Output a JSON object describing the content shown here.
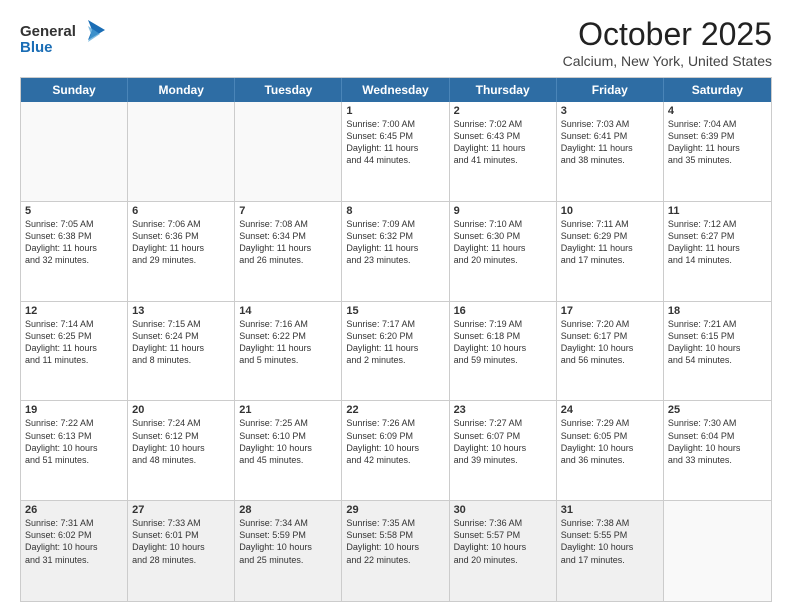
{
  "header": {
    "logo_general": "General",
    "logo_blue": "Blue",
    "month_title": "October 2025",
    "location": "Calcium, New York, United States"
  },
  "weekdays": [
    "Sunday",
    "Monday",
    "Tuesday",
    "Wednesday",
    "Thursday",
    "Friday",
    "Saturday"
  ],
  "weeks": [
    [
      {
        "day": "",
        "text": "",
        "empty": true
      },
      {
        "day": "",
        "text": "",
        "empty": true
      },
      {
        "day": "",
        "text": "",
        "empty": true
      },
      {
        "day": "1",
        "text": "Sunrise: 7:00 AM\nSunset: 6:45 PM\nDaylight: 11 hours\nand 44 minutes."
      },
      {
        "day": "2",
        "text": "Sunrise: 7:02 AM\nSunset: 6:43 PM\nDaylight: 11 hours\nand 41 minutes."
      },
      {
        "day": "3",
        "text": "Sunrise: 7:03 AM\nSunset: 6:41 PM\nDaylight: 11 hours\nand 38 minutes."
      },
      {
        "day": "4",
        "text": "Sunrise: 7:04 AM\nSunset: 6:39 PM\nDaylight: 11 hours\nand 35 minutes."
      }
    ],
    [
      {
        "day": "5",
        "text": "Sunrise: 7:05 AM\nSunset: 6:38 PM\nDaylight: 11 hours\nand 32 minutes."
      },
      {
        "day": "6",
        "text": "Sunrise: 7:06 AM\nSunset: 6:36 PM\nDaylight: 11 hours\nand 29 minutes."
      },
      {
        "day": "7",
        "text": "Sunrise: 7:08 AM\nSunset: 6:34 PM\nDaylight: 11 hours\nand 26 minutes."
      },
      {
        "day": "8",
        "text": "Sunrise: 7:09 AM\nSunset: 6:32 PM\nDaylight: 11 hours\nand 23 minutes."
      },
      {
        "day": "9",
        "text": "Sunrise: 7:10 AM\nSunset: 6:30 PM\nDaylight: 11 hours\nand 20 minutes."
      },
      {
        "day": "10",
        "text": "Sunrise: 7:11 AM\nSunset: 6:29 PM\nDaylight: 11 hours\nand 17 minutes."
      },
      {
        "day": "11",
        "text": "Sunrise: 7:12 AM\nSunset: 6:27 PM\nDaylight: 11 hours\nand 14 minutes."
      }
    ],
    [
      {
        "day": "12",
        "text": "Sunrise: 7:14 AM\nSunset: 6:25 PM\nDaylight: 11 hours\nand 11 minutes."
      },
      {
        "day": "13",
        "text": "Sunrise: 7:15 AM\nSunset: 6:24 PM\nDaylight: 11 hours\nand 8 minutes."
      },
      {
        "day": "14",
        "text": "Sunrise: 7:16 AM\nSunset: 6:22 PM\nDaylight: 11 hours\nand 5 minutes."
      },
      {
        "day": "15",
        "text": "Sunrise: 7:17 AM\nSunset: 6:20 PM\nDaylight: 11 hours\nand 2 minutes."
      },
      {
        "day": "16",
        "text": "Sunrise: 7:19 AM\nSunset: 6:18 PM\nDaylight: 10 hours\nand 59 minutes."
      },
      {
        "day": "17",
        "text": "Sunrise: 7:20 AM\nSunset: 6:17 PM\nDaylight: 10 hours\nand 56 minutes."
      },
      {
        "day": "18",
        "text": "Sunrise: 7:21 AM\nSunset: 6:15 PM\nDaylight: 10 hours\nand 54 minutes."
      }
    ],
    [
      {
        "day": "19",
        "text": "Sunrise: 7:22 AM\nSunset: 6:13 PM\nDaylight: 10 hours\nand 51 minutes."
      },
      {
        "day": "20",
        "text": "Sunrise: 7:24 AM\nSunset: 6:12 PM\nDaylight: 10 hours\nand 48 minutes."
      },
      {
        "day": "21",
        "text": "Sunrise: 7:25 AM\nSunset: 6:10 PM\nDaylight: 10 hours\nand 45 minutes."
      },
      {
        "day": "22",
        "text": "Sunrise: 7:26 AM\nSunset: 6:09 PM\nDaylight: 10 hours\nand 42 minutes."
      },
      {
        "day": "23",
        "text": "Sunrise: 7:27 AM\nSunset: 6:07 PM\nDaylight: 10 hours\nand 39 minutes."
      },
      {
        "day": "24",
        "text": "Sunrise: 7:29 AM\nSunset: 6:05 PM\nDaylight: 10 hours\nand 36 minutes."
      },
      {
        "day": "25",
        "text": "Sunrise: 7:30 AM\nSunset: 6:04 PM\nDaylight: 10 hours\nand 33 minutes."
      }
    ],
    [
      {
        "day": "26",
        "text": "Sunrise: 7:31 AM\nSunset: 6:02 PM\nDaylight: 10 hours\nand 31 minutes."
      },
      {
        "day": "27",
        "text": "Sunrise: 7:33 AM\nSunset: 6:01 PM\nDaylight: 10 hours\nand 28 minutes."
      },
      {
        "day": "28",
        "text": "Sunrise: 7:34 AM\nSunset: 5:59 PM\nDaylight: 10 hours\nand 25 minutes."
      },
      {
        "day": "29",
        "text": "Sunrise: 7:35 AM\nSunset: 5:58 PM\nDaylight: 10 hours\nand 22 minutes."
      },
      {
        "day": "30",
        "text": "Sunrise: 7:36 AM\nSunset: 5:57 PM\nDaylight: 10 hours\nand 20 minutes."
      },
      {
        "day": "31",
        "text": "Sunrise: 7:38 AM\nSunset: 5:55 PM\nDaylight: 10 hours\nand 17 minutes."
      },
      {
        "day": "",
        "text": "",
        "empty": true
      }
    ]
  ]
}
